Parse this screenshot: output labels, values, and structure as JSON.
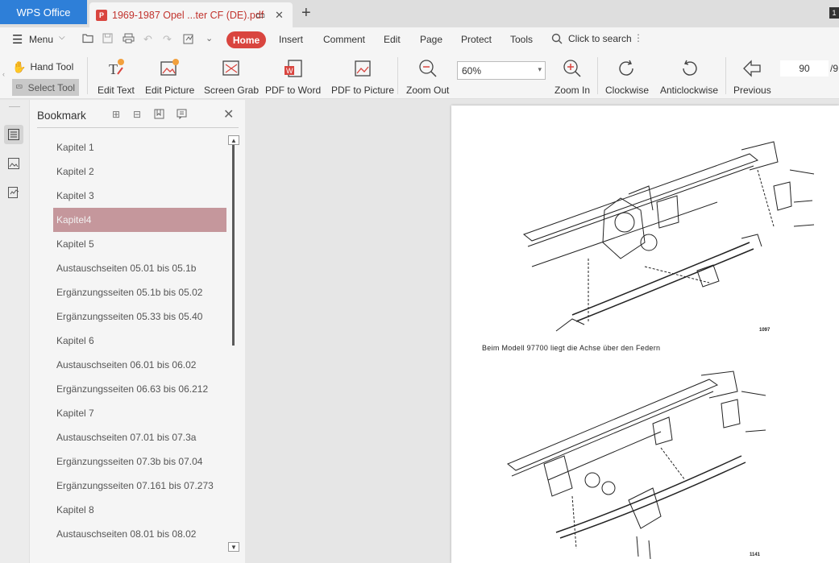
{
  "titlebar": {
    "app_tab": "WPS Office",
    "doc_tab": "1969-1987 Opel ...ter CF (DE).pdf",
    "window_badge": "1"
  },
  "menubar": {
    "menu_label": "Menu",
    "tabs": [
      "Home",
      "Insert",
      "Comment",
      "Edit",
      "Page",
      "Protect",
      "Tools"
    ],
    "search_label": "Click to search"
  },
  "toolbar": {
    "hand_tool": "Hand Tool",
    "select_tool": "Select Tool",
    "edit_text": "Edit Text",
    "edit_picture": "Edit Picture",
    "screen_grab": "Screen Grab",
    "pdf_to_word": "PDF to Word",
    "pdf_to_picture": "PDF to Picture",
    "zoom_out": "Zoom Out",
    "zoom_value": "60%",
    "zoom_in": "Zoom In",
    "clockwise": "Clockwise",
    "anticlockwise": "Anticlockwise",
    "previous": "Previous",
    "page_number": "90",
    "page_total": "/9"
  },
  "bookmark": {
    "title": "Bookmark",
    "selected_index": 3,
    "items": [
      "Kapitel 1",
      "Kapitel 2",
      "Kapitel 3",
      "Kapitel4",
      "Kapitel 5",
      "Austauschseiten 05.01 bis 05.1b",
      "Ergänzungsseiten 05.1b bis 05.02",
      "Ergänzungsseiten 05.33 bis 05.40",
      "Kapitel 6",
      "Austauschseiten 06.01 bis 06.02",
      "Ergänzungsseiten 06.63 bis 06.212",
      "Kapitel 7",
      "Austauschseiten 07.01 bis 07.3a",
      "Ergänzungsseiten 07.3b bis 07.04",
      "Ergänzungsseiten 07.161 bis 07.273",
      "Kapitel 8",
      "Austauschseiten 08.01 bis 08.02"
    ]
  },
  "document": {
    "caption": "Beim Modell 97700 liegt die Achse über den Federn",
    "figure_number_top": "1097",
    "figure_number_bottom": "1141"
  },
  "colors": {
    "accent": "#d9453f",
    "app_tab_blue": "#2e7fd8",
    "selected_bookmark": "#c5979c"
  }
}
